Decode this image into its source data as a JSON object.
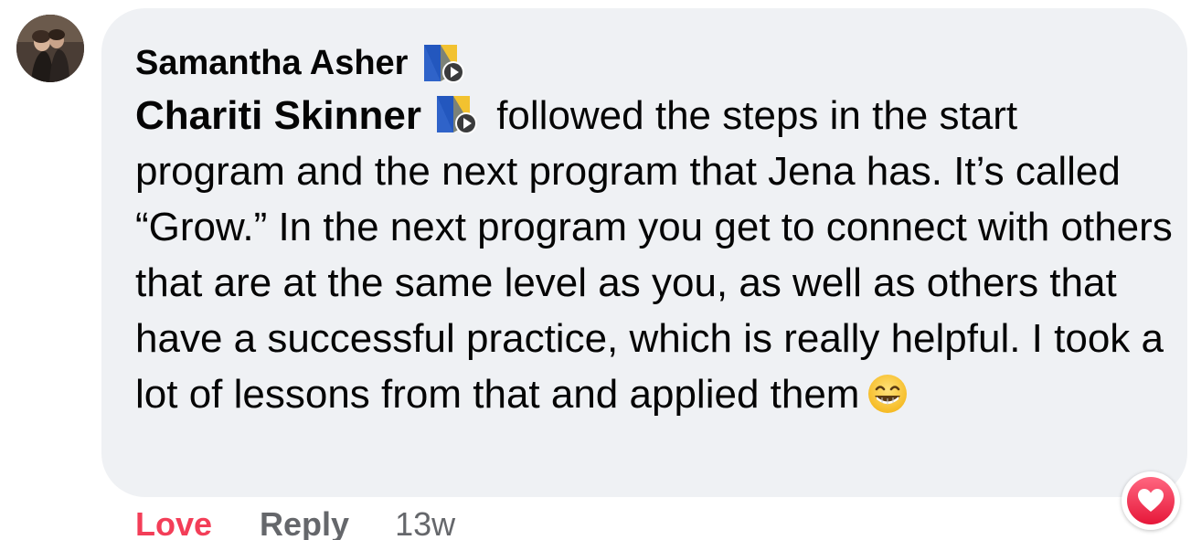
{
  "comment": {
    "author": "Samantha Asher",
    "author_badge_icon": "top-fan-badge-icon",
    "mention": "Chariti Skinner",
    "mention_badge_icon": "top-fan-badge-icon",
    "text_after_mention": " followed the steps in the start program and the next program that Jena has. It’s called “Grow.” In the next program you get to connect with others that are at the same level as you, as well as others that have a successful practice, which is really helpful. I took a lot of lessons from that and applied them",
    "emoji_icon": "grinning-face-icon",
    "bubble_color": "#eff1f4"
  },
  "reaction": {
    "icon": "love-reaction-icon",
    "color": "#f33e58"
  },
  "actions": {
    "love_label": "Love",
    "reply_label": "Reply",
    "timestamp": "13w",
    "love_color": "#f33e58",
    "muted_color": "#65676b"
  }
}
